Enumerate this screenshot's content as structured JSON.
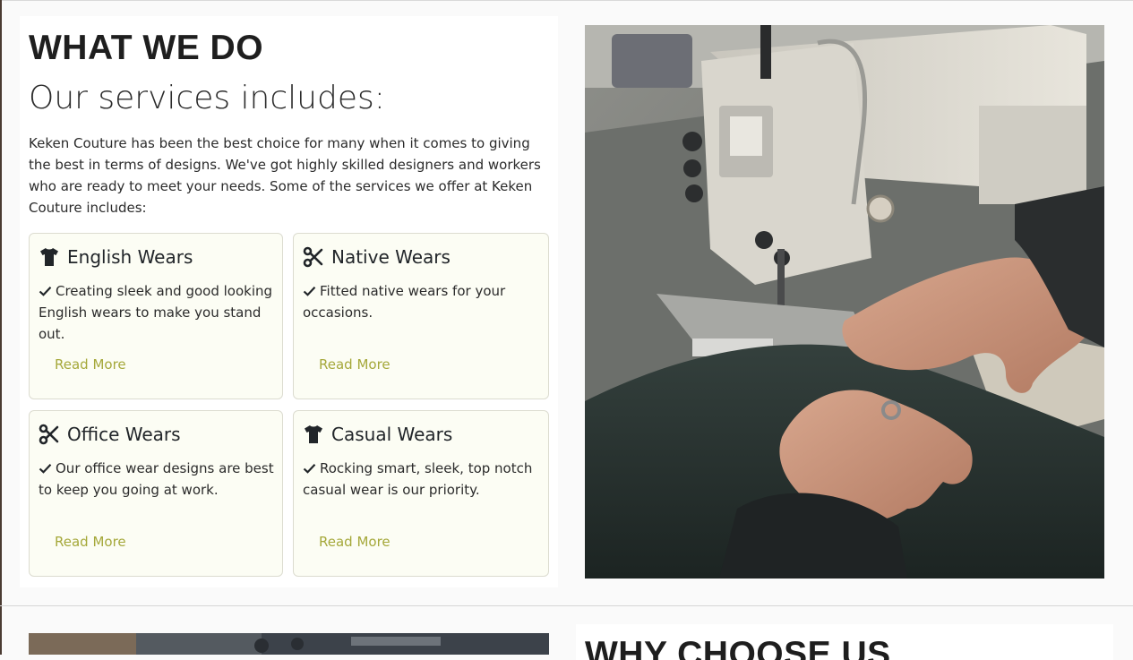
{
  "services": {
    "eyebrow": "WHAT WE DO",
    "subtitle": "Our services includes:",
    "intro": "Keken Couture has been the best choice for many when it comes to giving the best in terms of designs. We've got highly skilled designers and workers who are ready to meet your needs. Some of the services we offer at Keken Couture includes:",
    "cards": [
      {
        "icon": "tshirt-icon",
        "title": "English Wears",
        "description": "Creating sleek and good looking English wears to make you stand out.",
        "link": "Read More"
      },
      {
        "icon": "scissors-icon",
        "title": "Native Wears",
        "description": "Fitted native wears for your occasions.",
        "link": "Read More"
      },
      {
        "icon": "scissors-icon",
        "title": "Office Wears",
        "description": "Our office wear designs are best to keep you going at work.",
        "link": "Read More"
      },
      {
        "icon": "tshirt-icon",
        "title": "Casual Wears",
        "description": "Rocking smart, sleek, top notch casual wear is our priority.",
        "link": "Read More"
      }
    ]
  },
  "why": {
    "title": "WHY CHOOSE US"
  },
  "colors": {
    "accent": "#a5a83a",
    "card_background": "#fcfdf4",
    "heading": "#1e1e1e"
  }
}
